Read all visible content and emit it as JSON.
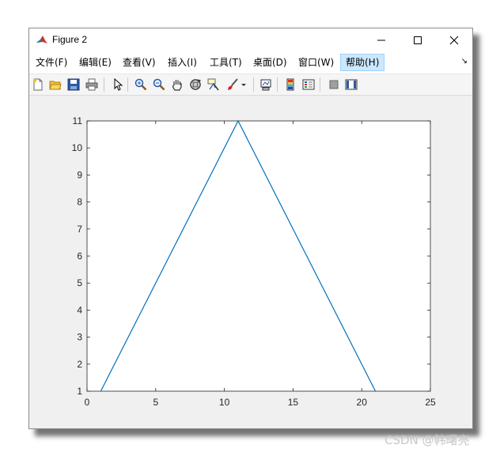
{
  "window": {
    "title": "Figure 2"
  },
  "menubar": {
    "items": [
      "文件(F)",
      "编辑(E)",
      "查看(V)",
      "插入(I)",
      "工具(T)",
      "桌面(D)",
      "窗口(W)",
      "帮助(H)"
    ],
    "active_index": 7
  },
  "toolbar": {
    "icons": [
      "new-figure-icon",
      "open-file-icon",
      "save-icon",
      "print-icon",
      "pointer-icon",
      "zoom-in-icon",
      "zoom-out-icon",
      "pan-icon",
      "rotate-3d-icon",
      "data-cursor-icon",
      "brush-icon",
      "link-plot-icon",
      "colorbar-icon",
      "legend-icon",
      "hide-plot-tools-icon",
      "show-plot-tools-icon"
    ]
  },
  "watermark": "CSDN @韩曙亮",
  "colors": {
    "line": "#0072bd",
    "menu_highlight": "#cce8ff"
  },
  "chart_data": {
    "type": "line",
    "x": [
      1,
      11,
      21
    ],
    "y": [
      1,
      11,
      1
    ],
    "xlim": [
      0,
      25
    ],
    "ylim": [
      1,
      11
    ],
    "xticks": [
      "0",
      "5",
      "10",
      "15",
      "20",
      "25"
    ],
    "yticks": [
      "1",
      "2",
      "3",
      "4",
      "5",
      "6",
      "7",
      "8",
      "9",
      "10",
      "11"
    ],
    "xlabel": "",
    "ylabel": "",
    "title": "",
    "grid": false
  }
}
